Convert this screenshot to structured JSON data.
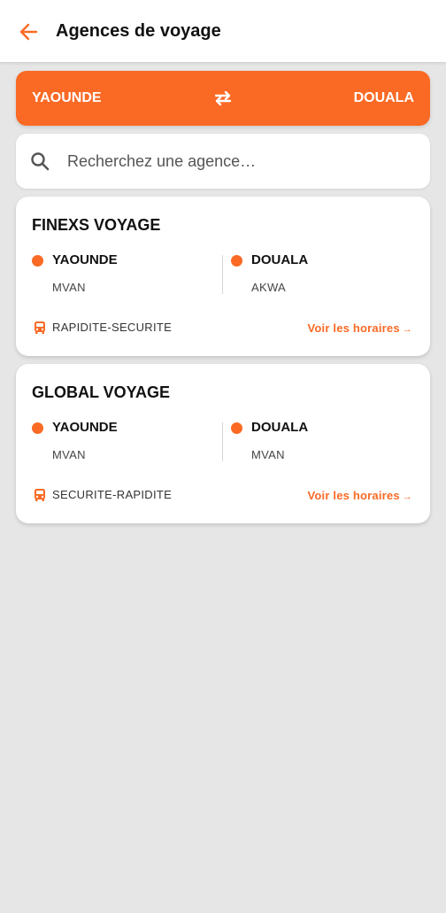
{
  "header": {
    "title": "Agences de voyage",
    "back_icon": "arrow-left-icon"
  },
  "route": {
    "from": "YAOUNDE",
    "to": "DOUALA",
    "swap_icon": "swap-horizontal-icon"
  },
  "search": {
    "placeholder": "Recherchez une agence…",
    "value": "",
    "icon": "search-icon"
  },
  "agencies": [
    {
      "name": "FINEXS VOYAGE",
      "from_city": "YAOUNDE",
      "from_area": "MVAN",
      "to_city": "DOUALA",
      "to_area": "AKWA",
      "tagline": "RAPIDITE-SECURITE",
      "link_label": "Voir les horaires",
      "link_arrow": "→"
    },
    {
      "name": "GLOBAL VOYAGE",
      "from_city": "YAOUNDE",
      "from_area": "MVAN",
      "to_city": "DOUALA",
      "to_area": "MVAN",
      "tagline": "SECURITE-RAPIDITE",
      "link_label": "Voir les horaires",
      "link_arrow": "→"
    }
  ],
  "colors": {
    "accent": "#fa6a25",
    "background": "#e6e6e6",
    "card": "#ffffff"
  }
}
